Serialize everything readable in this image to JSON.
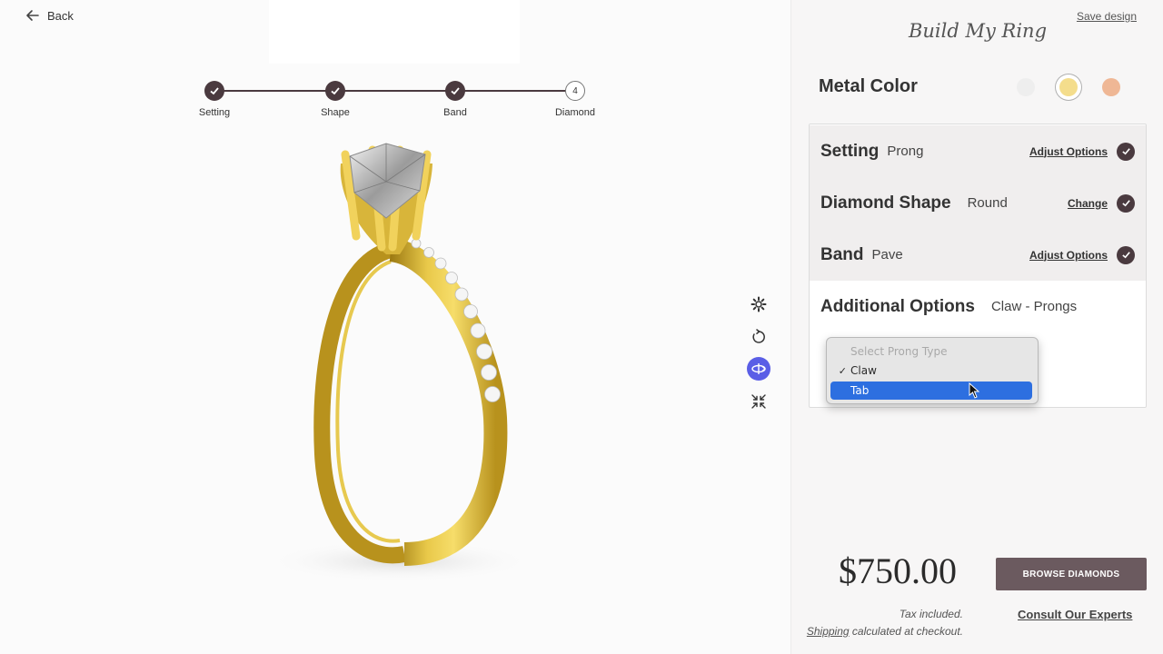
{
  "nav": {
    "back_label": "Back"
  },
  "stepper": {
    "steps": [
      {
        "label": "Setting",
        "status": "complete"
      },
      {
        "label": "Shape",
        "status": "complete"
      },
      {
        "label": "Band",
        "status": "complete"
      },
      {
        "label": "Diamond",
        "number": "4",
        "status": "current"
      }
    ]
  },
  "viewer_tools": [
    "settings-icon",
    "rotate-icon",
    "360-view-icon",
    "collapse-icon"
  ],
  "panel": {
    "save_label": "Save design",
    "title": "Build My Ring",
    "metal": {
      "label": "Metal Color",
      "options": [
        {
          "name": "white-gold",
          "color": "#eeeeee",
          "selected": false
        },
        {
          "name": "yellow-gold",
          "color": "#f4dd8c",
          "selected": true
        },
        {
          "name": "rose-gold",
          "color": "#efb795",
          "selected": false
        }
      ]
    },
    "options": {
      "setting": {
        "name": "Setting",
        "value": "Prong",
        "action": "Adjust Options"
      },
      "shape": {
        "name": "Diamond Shape",
        "value": "Round",
        "action": "Change"
      },
      "band": {
        "name": "Band",
        "value": "Pave",
        "action": "Adjust Options"
      },
      "additional": {
        "name": "Additional Options",
        "value": "Claw - Prongs"
      }
    },
    "dropdown": {
      "placeholder": "Select Prong Type",
      "items": [
        {
          "label": "Claw",
          "checked": true,
          "check": "✓"
        },
        {
          "label": "Tab",
          "highlighted": true
        }
      ]
    },
    "price": "$750.00",
    "browse_label": "BROWSE DIAMONDS",
    "tax_line": "Tax included.",
    "shipping_link": "Shipping",
    "shipping_rest": " calculated at checkout.",
    "consult_label": "Consult Our Experts"
  },
  "colors": {
    "accent_dark": "#4a3a3f",
    "button": "#6b5a5f",
    "highlight": "#2d6fe0",
    "tool_active": "#5a5ee6",
    "gold": "#e0bf3a"
  }
}
